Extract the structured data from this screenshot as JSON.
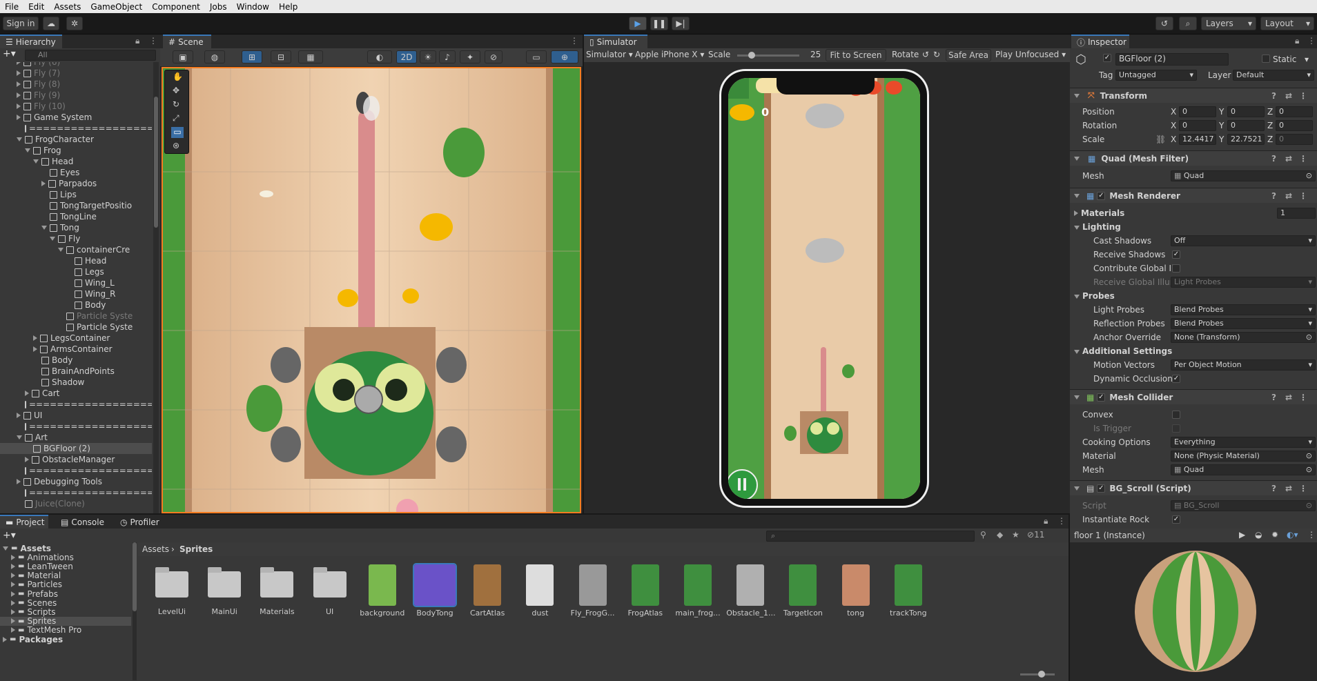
{
  "menu": [
    "File",
    "Edit",
    "Assets",
    "GameObject",
    "Component",
    "Jobs",
    "Window",
    "Help"
  ],
  "toolbar": {
    "sign_in": "Sign in",
    "layers": "Layers",
    "layout": "Layout"
  },
  "hierarchy": {
    "tab": "Hierarchy",
    "search_placeholder": "All",
    "rows": [
      {
        "label": "Fly (6)",
        "indent": 1,
        "arrow": "r",
        "dim": true
      },
      {
        "label": "Fly (7)",
        "indent": 1,
        "arrow": "r",
        "dim": true
      },
      {
        "label": "Fly (8)",
        "indent": 1,
        "arrow": "r",
        "dim": true
      },
      {
        "label": "Fly (9)",
        "indent": 1,
        "arrow": "r",
        "dim": true
      },
      {
        "label": "Fly (10)",
        "indent": 1,
        "arrow": "r",
        "dim": true
      },
      {
        "label": "Game System",
        "indent": 1,
        "arrow": "r"
      },
      {
        "label": "=====================",
        "indent": 1,
        "arrow": ""
      },
      {
        "label": "FrogCharacter",
        "indent": 1,
        "arrow": "d"
      },
      {
        "label": "Frog",
        "indent": 2,
        "arrow": "d"
      },
      {
        "label": "Head",
        "indent": 3,
        "arrow": "d"
      },
      {
        "label": "Eyes",
        "indent": 4,
        "arrow": ""
      },
      {
        "label": "Parpados",
        "indent": 4,
        "arrow": "r"
      },
      {
        "label": "Lips",
        "indent": 4,
        "arrow": ""
      },
      {
        "label": "TongTargetPositio",
        "indent": 4,
        "arrow": ""
      },
      {
        "label": "TongLine",
        "indent": 4,
        "arrow": ""
      },
      {
        "label": "Tong",
        "indent": 4,
        "arrow": "d"
      },
      {
        "label": "Fly",
        "indent": 5,
        "arrow": "d"
      },
      {
        "label": "containerCre",
        "indent": 6,
        "arrow": "d"
      },
      {
        "label": "Head",
        "indent": 7,
        "arrow": ""
      },
      {
        "label": "Legs",
        "indent": 7,
        "arrow": ""
      },
      {
        "label": "Wing_L",
        "indent": 7,
        "arrow": ""
      },
      {
        "label": "Wing_R",
        "indent": 7,
        "arrow": ""
      },
      {
        "label": "Body",
        "indent": 7,
        "arrow": ""
      },
      {
        "label": "Particle Syste",
        "indent": 6,
        "arrow": "",
        "dim": true
      },
      {
        "label": "Particle Syste",
        "indent": 6,
        "arrow": ""
      },
      {
        "label": "LegsContainer",
        "indent": 3,
        "arrow": "r"
      },
      {
        "label": "ArmsContainer",
        "indent": 3,
        "arrow": "r"
      },
      {
        "label": "Body",
        "indent": 3,
        "arrow": ""
      },
      {
        "label": "BrainAndPoints",
        "indent": 3,
        "arrow": ""
      },
      {
        "label": "Shadow",
        "indent": 3,
        "arrow": ""
      },
      {
        "label": "Cart",
        "indent": 2,
        "arrow": "r"
      },
      {
        "label": "=====================",
        "indent": 1,
        "arrow": ""
      },
      {
        "label": "UI",
        "indent": 1,
        "arrow": "r"
      },
      {
        "label": "=====================",
        "indent": 1,
        "arrow": ""
      },
      {
        "label": "Art",
        "indent": 1,
        "arrow": "d"
      },
      {
        "label": "BGFloor (2)",
        "indent": 2,
        "arrow": "",
        "selected": true
      },
      {
        "label": "ObstacleManager",
        "indent": 2,
        "arrow": "r"
      },
      {
        "label": "=====================",
        "indent": 1,
        "arrow": ""
      },
      {
        "label": "Debugging Tools",
        "indent": 1,
        "arrow": "r"
      },
      {
        "label": "=====================",
        "indent": 1,
        "arrow": ""
      },
      {
        "label": "Juice(Clone)",
        "indent": 1,
        "arrow": "",
        "dim": true
      }
    ]
  },
  "scene": {
    "tab": "Scene",
    "mode_2d": "2D"
  },
  "simulator": {
    "tab": "Simulator",
    "mode": "Simulator",
    "device": "Apple iPhone X",
    "scale_label": "Scale",
    "scale_value": "25",
    "fit": "Fit to Screen",
    "rotate": "Rotate",
    "safe_area": "Safe Area",
    "play_mode": "Play Unfocused",
    "score": "0"
  },
  "inspector": {
    "tab": "Inspector",
    "object_name": "BGFloor (2)",
    "static_label": "Static",
    "tag_label": "Tag",
    "tag_value": "Untagged",
    "layer_label": "Layer",
    "layer_value": "Default",
    "transform": {
      "title": "Transform",
      "position": "Position",
      "rotation": "Rotation",
      "scale": "Scale",
      "pos": [
        "0",
        "0",
        "0"
      ],
      "rot": [
        "0",
        "0",
        "0"
      ],
      "scl": [
        "12.4417",
        "22.7521",
        "0"
      ]
    },
    "mesh_filter": {
      "title": "Quad (Mesh Filter)",
      "mesh_label": "Mesh",
      "mesh_value": "Quad"
    },
    "mesh_renderer": {
      "title": "Mesh Renderer",
      "materials": "Materials",
      "materials_count": "1",
      "lighting": "Lighting",
      "cast_shadows": "Cast Shadows",
      "cast_shadows_value": "Off",
      "receive_shadows": "Receive Shadows",
      "contribute_gi": "Contribute Global Ill",
      "receive_gi": "Receive Global Illun",
      "receive_gi_value": "Light Probes",
      "probes": "Probes",
      "light_probes": "Light Probes",
      "light_probes_value": "Blend Probes",
      "reflection_probes": "Reflection Probes",
      "reflection_probes_value": "Blend Probes",
      "anchor_override": "Anchor Override",
      "anchor_override_value": "None (Transform)",
      "additional": "Additional Settings",
      "motion_vectors": "Motion Vectors",
      "motion_vectors_value": "Per Object Motion",
      "dynamic_occlusion": "Dynamic Occlusion"
    },
    "mesh_collider": {
      "title": "Mesh Collider",
      "convex": "Convex",
      "is_trigger": "Is Trigger",
      "cooking": "Cooking Options",
      "cooking_value": "Everything",
      "material": "Material",
      "material_value": "None (Physic Material)",
      "mesh": "Mesh",
      "mesh_value": "Quad"
    },
    "bg_scroll": {
      "title": "BG_Scroll (Script)",
      "script": "Script",
      "script_value": "BG_Scroll",
      "instantiate_rock": "Instantiate Rock"
    },
    "preview_title": "floor 1 (Instance)"
  },
  "bottom": {
    "tabs": [
      "Project",
      "Console",
      "Profiler"
    ],
    "tree": [
      "Assets",
      "Animations",
      "LeanTween",
      "Material",
      "Particles",
      "Prefabs",
      "Scenes",
      "Scripts",
      "Sprites",
      "TextMesh Pro",
      "Packages"
    ],
    "breadcrumb_root": "Assets",
    "breadcrumb_leaf": "Sprites",
    "hidden_count": "11",
    "items": [
      "LevelUi",
      "MainUi",
      "Materials",
      "UI",
      "background",
      "BodyTong",
      "CartAtlas",
      "dust",
      "Fly_FrogG...",
      "FrogAtlas",
      "main_frog...",
      "Obstacle_1...",
      "TargetIcon",
      "tong",
      "trackTong"
    ]
  }
}
